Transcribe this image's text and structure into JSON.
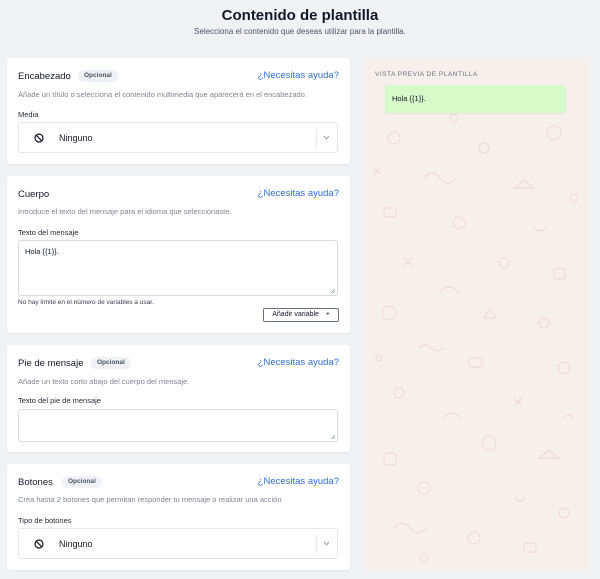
{
  "header": {
    "title": "Contenido de plantilla",
    "subtitle": "Selecciona el contenido que deseas utilizar para la plantilla."
  },
  "help_link": "¿Necesitas ayuda?",
  "sections": {
    "header_section": {
      "title": "Encabezado",
      "badge": "Opcional",
      "description": "Añade un título o selecciona el contenido multimedia que aparecerá en el encabezado.",
      "field_label": "Media",
      "select_value": "Ninguno"
    },
    "body_section": {
      "title": "Cuerpo",
      "description": "Introduce el texto del mensaje para el idioma que seleccionaste.",
      "field_label": "Texto del mensaje",
      "textarea_value": "Hola {{1}}.",
      "hint": "No hay límite en el número de variables a usar.",
      "add_variable_label": "Añadir variable",
      "add_variable_icon": "+"
    },
    "footer_section": {
      "title": "Pie de mensaje",
      "badge": "Opcional",
      "description": "Añade un texto corto abajo del cuerpo del mensaje.",
      "field_label": "Texto del pie de mensaje",
      "textarea_value": ""
    },
    "buttons_section": {
      "title": "Botones",
      "badge": "Opcional",
      "description": "Crea hasta 2 botones que permitan responder tu mensaje o realizar una acción",
      "field_label": "Tipo de botones",
      "select_value": "Ninguno"
    }
  },
  "preview": {
    "label": "VISTA PREVIA DE PLANTILLA",
    "message": "Hola {{1}}."
  },
  "colors": {
    "accent": "#2f6fd6",
    "bubble": "#d7fbc8",
    "preview_bg": "#f6efec"
  },
  "icons": {
    "none": "ban-icon",
    "dropdown": "chevron-down-icon",
    "resize": "resize-grip-icon"
  }
}
